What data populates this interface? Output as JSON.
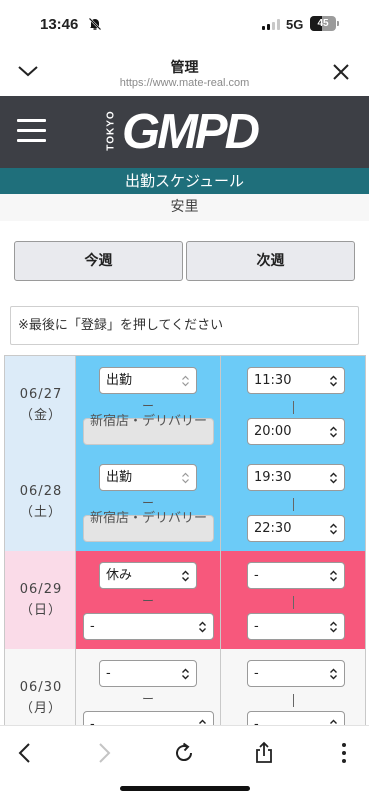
{
  "status_bar": {
    "time": "13:46",
    "network": "5G",
    "battery": "45",
    "battery_level": 0.45
  },
  "browser": {
    "title": "管理",
    "url": "https://www.mate-real.com"
  },
  "site": {
    "logo_small": "TOKYO",
    "logo_big": "GMPD",
    "section_title": "出勤スケジュール",
    "staff_name": "安里"
  },
  "week_buttons": {
    "this_week": "今週",
    "next_week": "次週"
  },
  "notice": "※最後に「登録」を押してください",
  "schedule": [
    {
      "date": "06/27",
      "weekday": "（金）",
      "status": "出勤",
      "separator": "ー",
      "store": "新宿店・デリバリー",
      "start": "11:30",
      "end": "20:00"
    },
    {
      "date": "06/28",
      "weekday": "（土）",
      "status": "出勤",
      "separator": "ー",
      "store": "新宿店・デリバリー",
      "start": "19:30",
      "end": "22:30"
    },
    {
      "date": "06/29",
      "weekday": "（日）",
      "status": "休み",
      "separator": "ー",
      "store": "-",
      "start": "-",
      "end": "-"
    },
    {
      "date": "06/30",
      "weekday": "（月）",
      "status": "-",
      "separator": "ー",
      "store": "-",
      "start": "-",
      "end": "-"
    }
  ],
  "colors": {
    "header_bg": "#3d3f45",
    "teal": "#1f6f7b",
    "work_blue": "#6ccbf7",
    "work_date_bg": "#dcebf8",
    "off_pink": "#f7587c",
    "off_date_bg": "#fadbe8",
    "empty_bg": "#f7f7f7"
  },
  "icons": {
    "status_mute": "bell-slash-icon",
    "collapse": "chevron-down-icon",
    "close": "close-icon",
    "menu": "hamburger-icon",
    "select": "select-arrows-icon",
    "back": "back-arrow-icon",
    "forward": "forward-arrow-icon",
    "reload": "reload-icon",
    "share": "share-icon",
    "more": "more-icon"
  }
}
